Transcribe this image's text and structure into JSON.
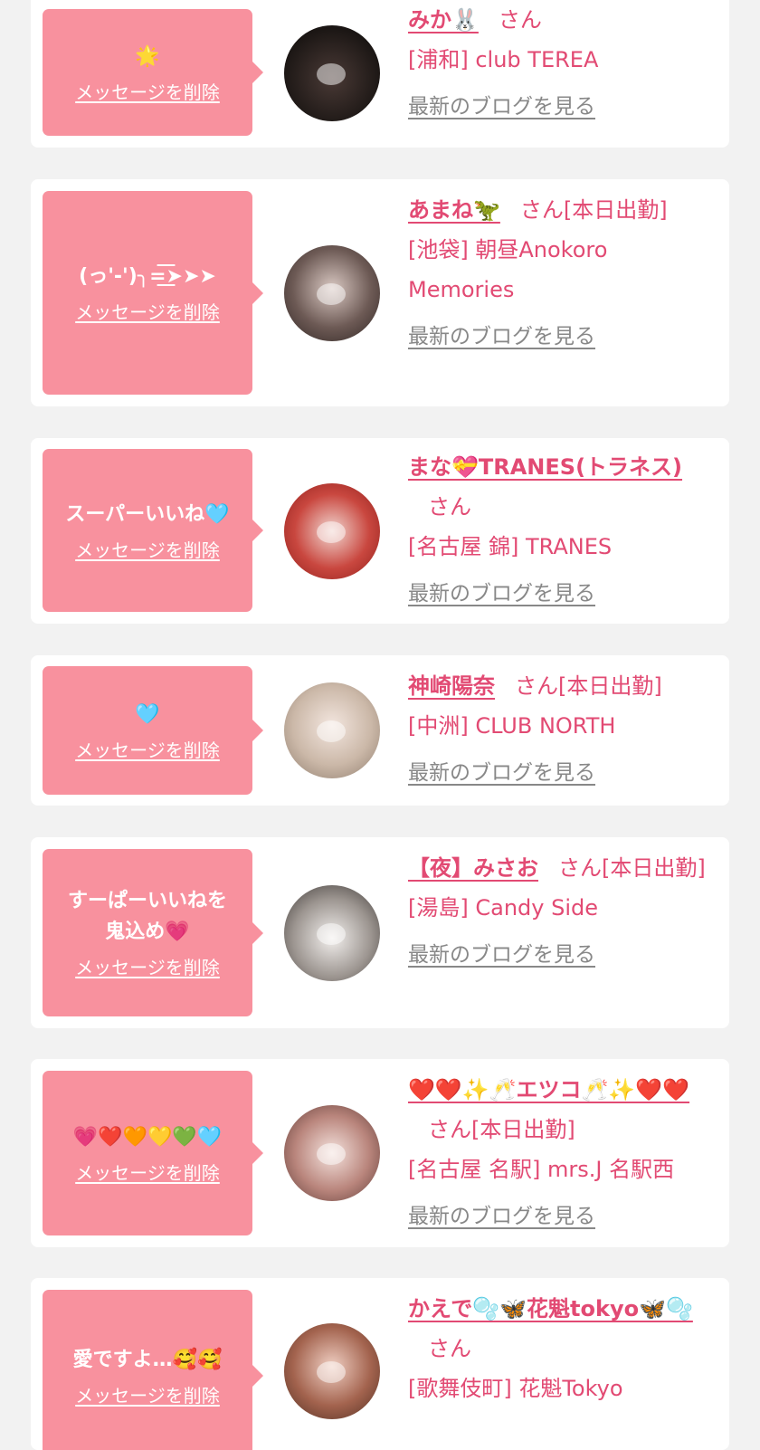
{
  "delete_label": "メッセージを削除",
  "blog_label": "最新のブログを見る",
  "accent_color": "#f8919e",
  "name_color": "#e24a73",
  "items": [
    {
      "message": "🌟",
      "name": "みか🐰",
      "honorific": "さん",
      "tag": "",
      "location": "[浦和] club TEREA"
    },
    {
      "message": "(っ'-')╮=͟͟͞͞➤➤➤",
      "name": "あまね🦖",
      "honorific": "さん",
      "tag": "[本日出勤]",
      "location": "[池袋] 朝昼Anokoro Memories"
    },
    {
      "message": "スーパーいいね🩵",
      "name": "まな💝TRANES(トラネス)",
      "honorific": "さん",
      "tag": "",
      "location": "[名古屋 錦] TRANES"
    },
    {
      "message": "🩵",
      "name": "神崎陽奈",
      "honorific": "さん",
      "tag": "[本日出勤]",
      "location": "[中洲] CLUB NORTH"
    },
    {
      "message": "すーぱーいいねを\n鬼込め💗",
      "name": "【夜】みさお",
      "honorific": "さん",
      "tag": "[本日出勤]",
      "location": "[湯島] Candy Side"
    },
    {
      "message": "💗❤️🧡💛💚🩵",
      "name": "❤️❤️✨🥂エツコ🥂✨❤️❤️",
      "honorific": "さん",
      "tag": "[本日出勤]",
      "location": "[名古屋 名駅] mrs.J 名駅西"
    },
    {
      "message": "愛ですよ…🥰🥰",
      "name": "かえで🫧🦋花魁tokyo🦋🫧",
      "honorific": "さん",
      "tag": "",
      "location": "[歌舞伎町] 花魁Tokyo"
    }
  ]
}
